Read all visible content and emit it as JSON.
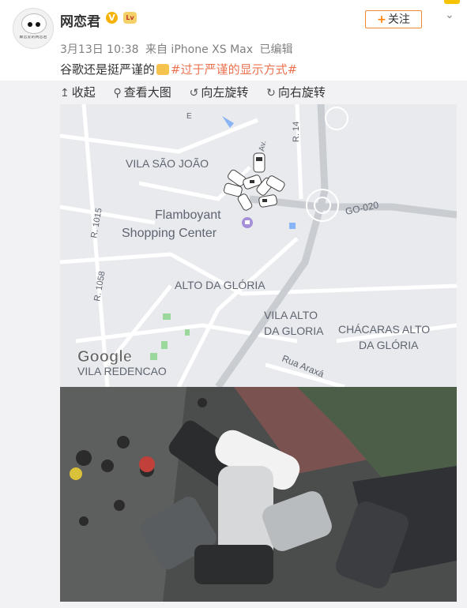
{
  "post": {
    "author_name": "网恋君",
    "verified_badge": "V",
    "level_badge": "Lv",
    "avatar_caption": "聚恋爱的网恋君",
    "follow_label": "关注",
    "meta": {
      "date": "3月13日 10:38",
      "source": "来自 iPhone XS Max",
      "edited": "已编辑"
    },
    "text": "谷歌还是挺严谨的",
    "hashtag": "#过于严谨的显示方式#"
  },
  "toolbar": {
    "collect": "收起",
    "view_large": "查看大图",
    "rotate_left": "向左旋转",
    "rotate_right": "向右旋转"
  },
  "map": {
    "labels": {
      "vila_sao_joao": "VILA SÃO JOÃO",
      "flamboyant_1": "Flamboyant",
      "flamboyant_2": "Shopping Center",
      "alto_da_gloria": "ALTO DA GLÓRIA",
      "vila_alto_1": "VILA ALTO",
      "vila_alto_2": "DA GLORIA",
      "chacaras_1": "CHÁCARAS ALTO",
      "chacaras_2": "DA GLÓRIA",
      "rua_araxa": "Rua Araxá",
      "vila_redencao": "VILA REDENCAO",
      "go_020": "GO-020",
      "r1015": "R. 1015",
      "r1058": "R. 1058",
      "r14": "R. 14",
      "av": "Av.",
      "e": "E",
      "google": "Google"
    }
  },
  "colors": {
    "accent_orange": "#ff8200",
    "hashtag": "#eb7350",
    "meta_gray": "#808080"
  }
}
